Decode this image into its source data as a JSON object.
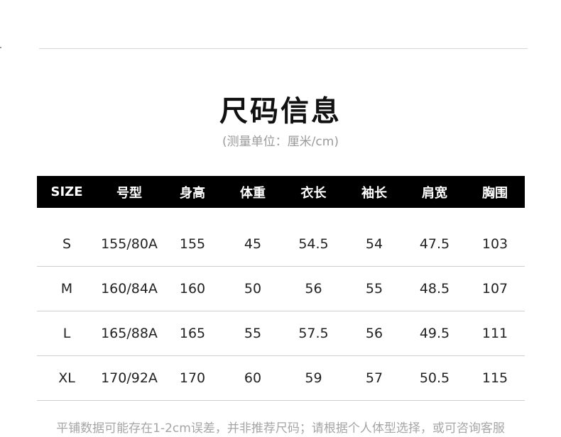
{
  "title": "尺码信息",
  "subtitle": "(测量单位：厘米/cm)",
  "table": {
    "headers": [
      "SIZE",
      "号型",
      "身高",
      "体重",
      "衣长",
      "袖长",
      "肩宽",
      "胸围"
    ],
    "rows": [
      [
        "S",
        "155/80A",
        "155",
        "45",
        "54.5",
        "54",
        "47.5",
        "103"
      ],
      [
        "M",
        "160/84A",
        "160",
        "50",
        "56",
        "55",
        "48.5",
        "107"
      ],
      [
        "L",
        "165/88A",
        "165",
        "55",
        "57.5",
        "56",
        "49.5",
        "111"
      ],
      [
        "XL",
        "170/92A",
        "170",
        "60",
        "59",
        "57",
        "50.5",
        "115"
      ]
    ]
  },
  "footnote": "平铺数据可能存在1-2cm误差，并非推荐尺码；请根据个人体型选择，或可咨询客服",
  "colors": {
    "header_background": "#000000",
    "header_text": "#ffffff",
    "muted_text": "#9a9a9a",
    "divider": "#cfcfcf"
  }
}
